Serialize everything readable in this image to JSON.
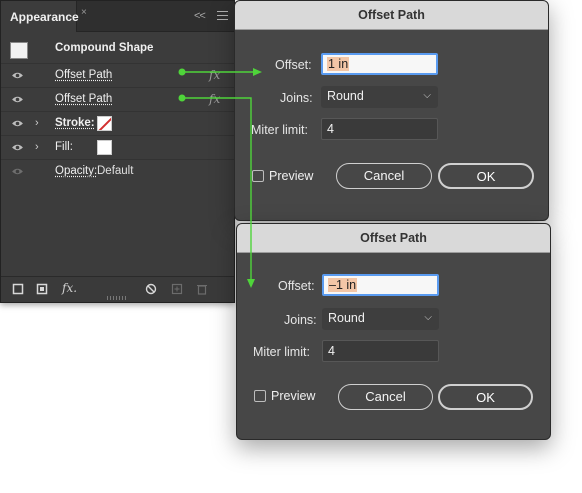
{
  "panel": {
    "tab_label": "Appearance",
    "close_glyph": "×",
    "collapse_glyph": "<<",
    "rows": [
      {
        "label": "Compound Shape"
      },
      {
        "label": "Offset Path",
        "fx": "fx"
      },
      {
        "label": "Offset Path",
        "fx": "fx"
      },
      {
        "label": "Stroke:"
      },
      {
        "label": "Fill:"
      },
      {
        "label": "Opacity:",
        "value": "Default"
      }
    ],
    "footer": {
      "fx_label": "fx."
    }
  },
  "dialog1": {
    "title": "Offset Path",
    "offset_label": "Offset:",
    "offset_value": "1 in",
    "joins_label": "Joins:",
    "joins_value": "Round",
    "miter_label": "Miter limit:",
    "miter_value": "4",
    "preview_label": "Preview",
    "cancel_label": "Cancel",
    "ok_label": "OK"
  },
  "dialog2": {
    "title": "Offset Path",
    "offset_label": "Offset:",
    "offset_value": "–1 in",
    "joins_label": "Joins:",
    "joins_value": "Round",
    "miter_label": "Miter limit:",
    "miter_value": "4",
    "preview_label": "Preview",
    "cancel_label": "Cancel",
    "ok_label": "OK"
  },
  "colors": {
    "annotation_arrow": "#4fd43a",
    "focus_ring": "#5a9bf0",
    "selection_highlight": "#f3c6a7"
  }
}
